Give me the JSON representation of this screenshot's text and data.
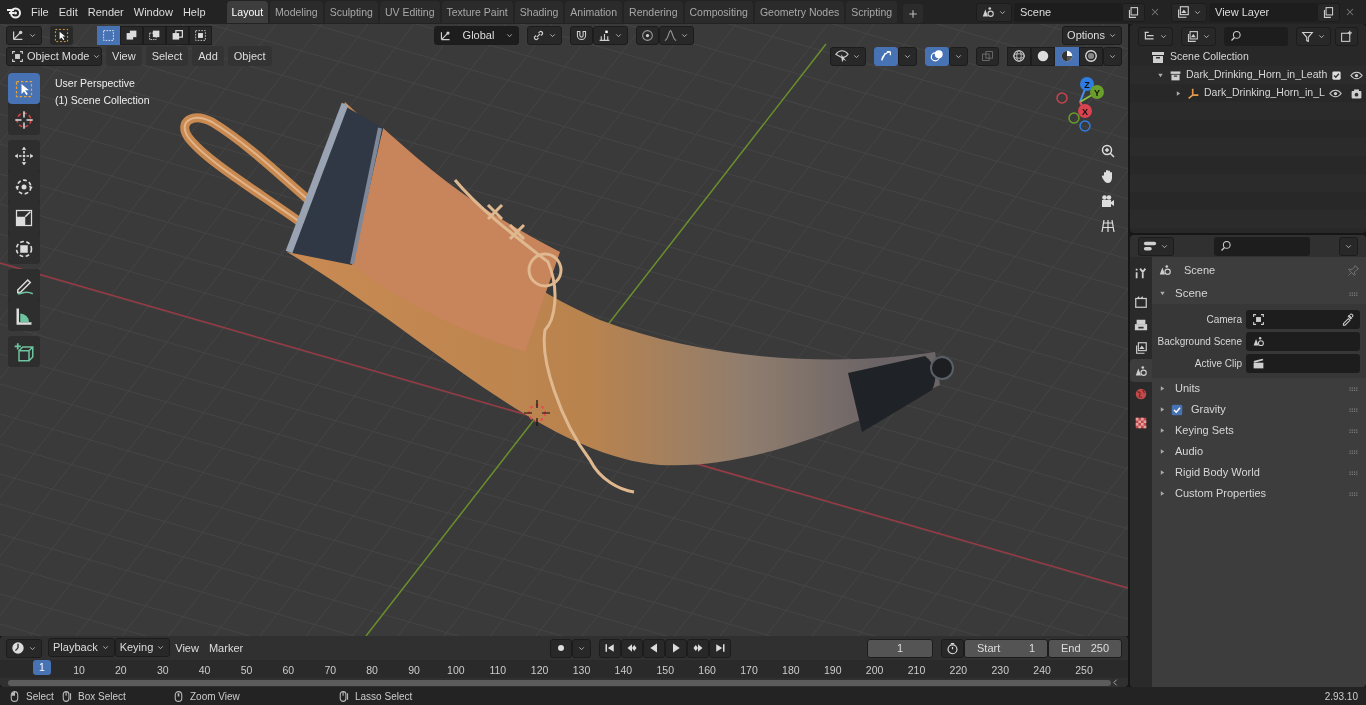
{
  "top_bar": {
    "menus": [
      "File",
      "Edit",
      "Render",
      "Window",
      "Help"
    ],
    "workspaces": [
      {
        "label": "Layout",
        "selected": true
      },
      {
        "label": "Modeling",
        "selected": false
      },
      {
        "label": "Sculpting",
        "selected": false
      },
      {
        "label": "UV Editing",
        "selected": false
      },
      {
        "label": "Texture Paint",
        "selected": false
      },
      {
        "label": "Shading",
        "selected": false
      },
      {
        "label": "Animation",
        "selected": false
      },
      {
        "label": "Rendering",
        "selected": false
      },
      {
        "label": "Compositing",
        "selected": false
      },
      {
        "label": "Geometry Nodes",
        "selected": false
      },
      {
        "label": "Scripting",
        "selected": false
      }
    ],
    "scene": "Scene",
    "view_layer": "View Layer"
  },
  "tool_header": {
    "select_modes": [
      {
        "selected": true
      },
      {
        "selected": false
      },
      {
        "selected": false
      },
      {
        "selected": false
      },
      {
        "selected": false
      }
    ],
    "orientation": "Global",
    "options": "Options"
  },
  "viewport_header": {
    "mode": "Object Mode",
    "menus": [
      "View",
      "Select",
      "Add",
      "Object"
    ],
    "gizmos": true,
    "overlays": true,
    "shading": [
      {
        "kind": "wireframe",
        "selected": false
      },
      {
        "kind": "solid",
        "selected": false
      },
      {
        "kind": "material",
        "selected": true
      },
      {
        "kind": "rendered",
        "selected": false
      }
    ]
  },
  "viewport": {
    "overlay_text": [
      "User Perspective",
      "(1) Scene Collection"
    ],
    "tool_groups": [
      [
        {
          "kind": "select",
          "selected": true
        },
        {
          "kind": "cursor",
          "selected": false
        }
      ],
      [
        {
          "kind": "move",
          "selected": false
        },
        {
          "kind": "rotate",
          "selected": false
        },
        {
          "kind": "scale",
          "selected": false
        },
        {
          "kind": "transform",
          "selected": false
        }
      ],
      [
        {
          "kind": "annotate",
          "selected": false
        },
        {
          "kind": "measure",
          "selected": false
        }
      ],
      [
        {
          "kind": "add_cube",
          "selected": false
        }
      ]
    ],
    "axes": [
      "Z",
      "Y",
      "X"
    ]
  },
  "outliner": {
    "tree": [
      {
        "label": "Scene Collection",
        "kind": "scene",
        "children": [
          {
            "label": "Dark_Drinking_Horn_in_Leath",
            "kind": "collection",
            "expanded": true,
            "checked": true,
            "children": [
              {
                "label": "Dark_Drinking_Horn_in_L",
                "kind": "object",
                "expanded": false
              }
            ]
          }
        ]
      }
    ]
  },
  "properties": {
    "tab_groups": [
      [
        {
          "kind": "tool",
          "selected": false
        }
      ],
      [
        {
          "kind": "render",
          "selected": false
        },
        {
          "kind": "output",
          "selected": false
        },
        {
          "kind": "view_layer",
          "selected": false
        },
        {
          "kind": "scene",
          "selected": true
        },
        {
          "kind": "world",
          "selected": false
        }
      ],
      [
        {
          "kind": "texture",
          "selected": false
        }
      ]
    ],
    "context": "Scene",
    "panel": {
      "label": "Scene",
      "expanded": true,
      "fields": [
        {
          "label": "Camera",
          "kind": "camera"
        },
        {
          "label": "Background Scene",
          "kind": "scene"
        },
        {
          "label": "Active Clip",
          "kind": "clip"
        }
      ]
    },
    "subpanels": [
      {
        "label": "Units",
        "expanded": false
      },
      {
        "label": "Gravity",
        "expanded": false,
        "checked": true
      },
      {
        "label": "Keying Sets",
        "expanded": false
      },
      {
        "label": "Audio",
        "expanded": false
      },
      {
        "label": "Rigid Body World",
        "expanded": false
      },
      {
        "label": "Custom Properties",
        "expanded": false
      }
    ]
  },
  "timeline": {
    "menus": [
      {
        "label": "Playback",
        "kind": "dropdown"
      },
      {
        "label": "Keying",
        "kind": "dropdown"
      },
      {
        "label": "View",
        "kind": "menu"
      },
      {
        "label": "Marker",
        "kind": "menu"
      }
    ],
    "auto_keying": false,
    "current_frame": "1",
    "start_label": "Start",
    "start": "1",
    "end_label": "End",
    "end": "250",
    "playhead": "1",
    "ruler": [
      "10",
      "20",
      "30",
      "40",
      "50",
      "60",
      "70",
      "80",
      "90",
      "100",
      "110",
      "120",
      "130",
      "140",
      "150",
      "160",
      "170",
      "180",
      "190",
      "200",
      "210",
      "220",
      "230",
      "240",
      "250"
    ]
  },
  "status_bar": {
    "hints": [
      {
        "label": "Select",
        "kind": "click"
      },
      {
        "label": "Box Select",
        "kind": "drag"
      },
      {
        "label": "Zoom View",
        "kind": "middle"
      },
      {
        "label": "Lasso Select",
        "kind": "drag"
      }
    ],
    "version": "2.93.10"
  }
}
